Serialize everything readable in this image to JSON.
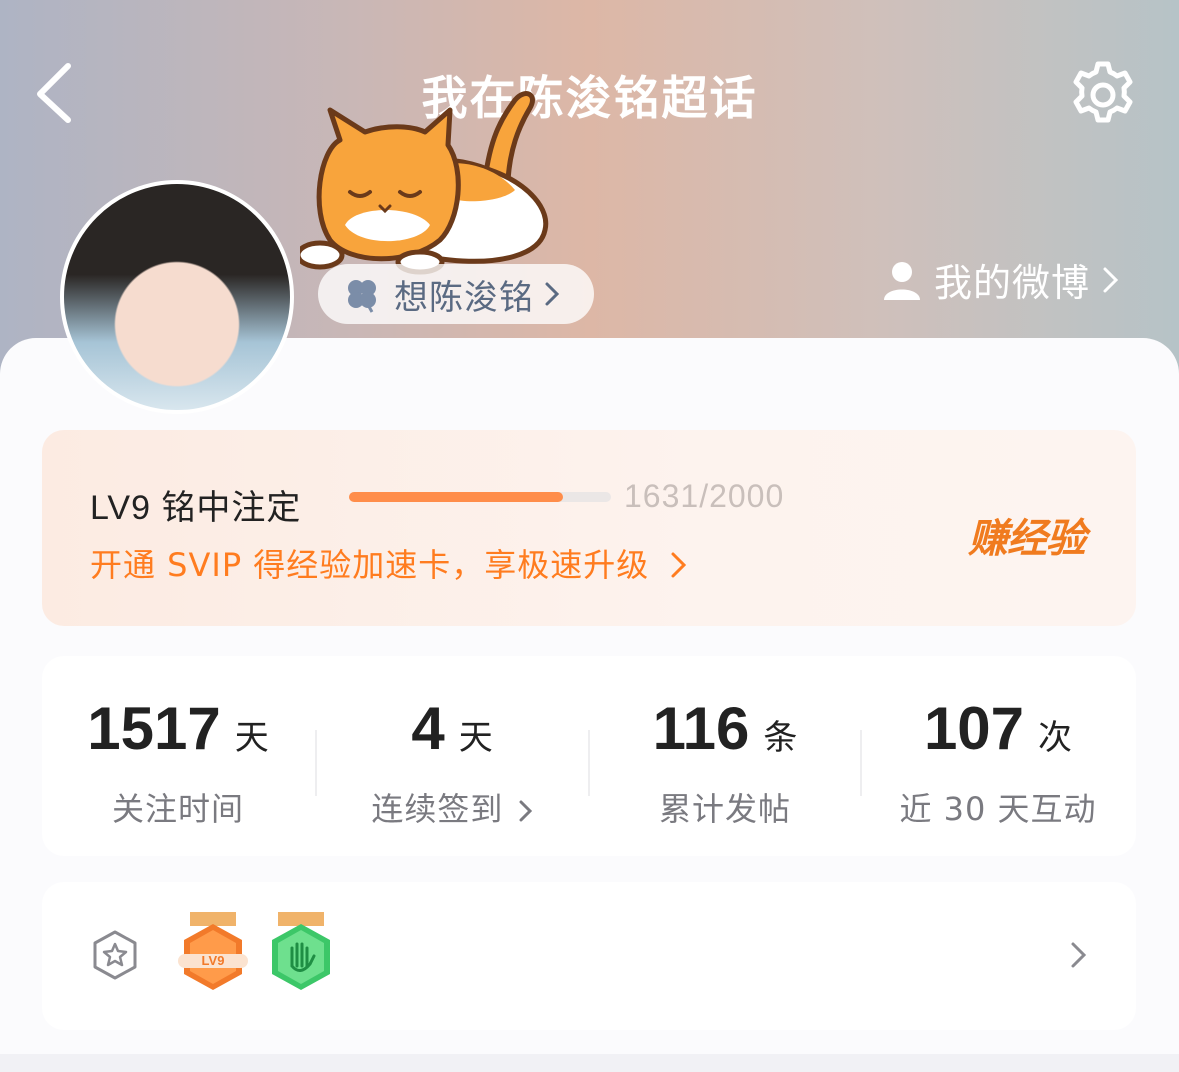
{
  "header": {
    "title": "我在陈浚铭超话",
    "nickname": "想陈浚铭",
    "my_weibo_label": "我的微博"
  },
  "level": {
    "title": "LV9",
    "name": "铭中注定",
    "progress_text": "1631/2000",
    "progress_fraction": 0.8155,
    "svip_promo": "开通 SVIP 得经验加速卡，享极速升级",
    "earn_label": "赚经验"
  },
  "stats": [
    {
      "value": "1517",
      "unit": "天",
      "label": "关注时间"
    },
    {
      "value": "4",
      "unit": "天",
      "label": "连续签到"
    },
    {
      "value": "116",
      "unit": "条",
      "label": "累计发帖"
    },
    {
      "value": "107",
      "unit": "次",
      "label": "近 30 天互动"
    }
  ],
  "badges": [
    {
      "icon": "lv9-badge-icon",
      "text": "LV9"
    },
    {
      "icon": "hand-badge-icon"
    }
  ],
  "colors": {
    "accent": "#ff7c1f",
    "progress": "#ff8d4a",
    "earn": "#f07b1f"
  }
}
